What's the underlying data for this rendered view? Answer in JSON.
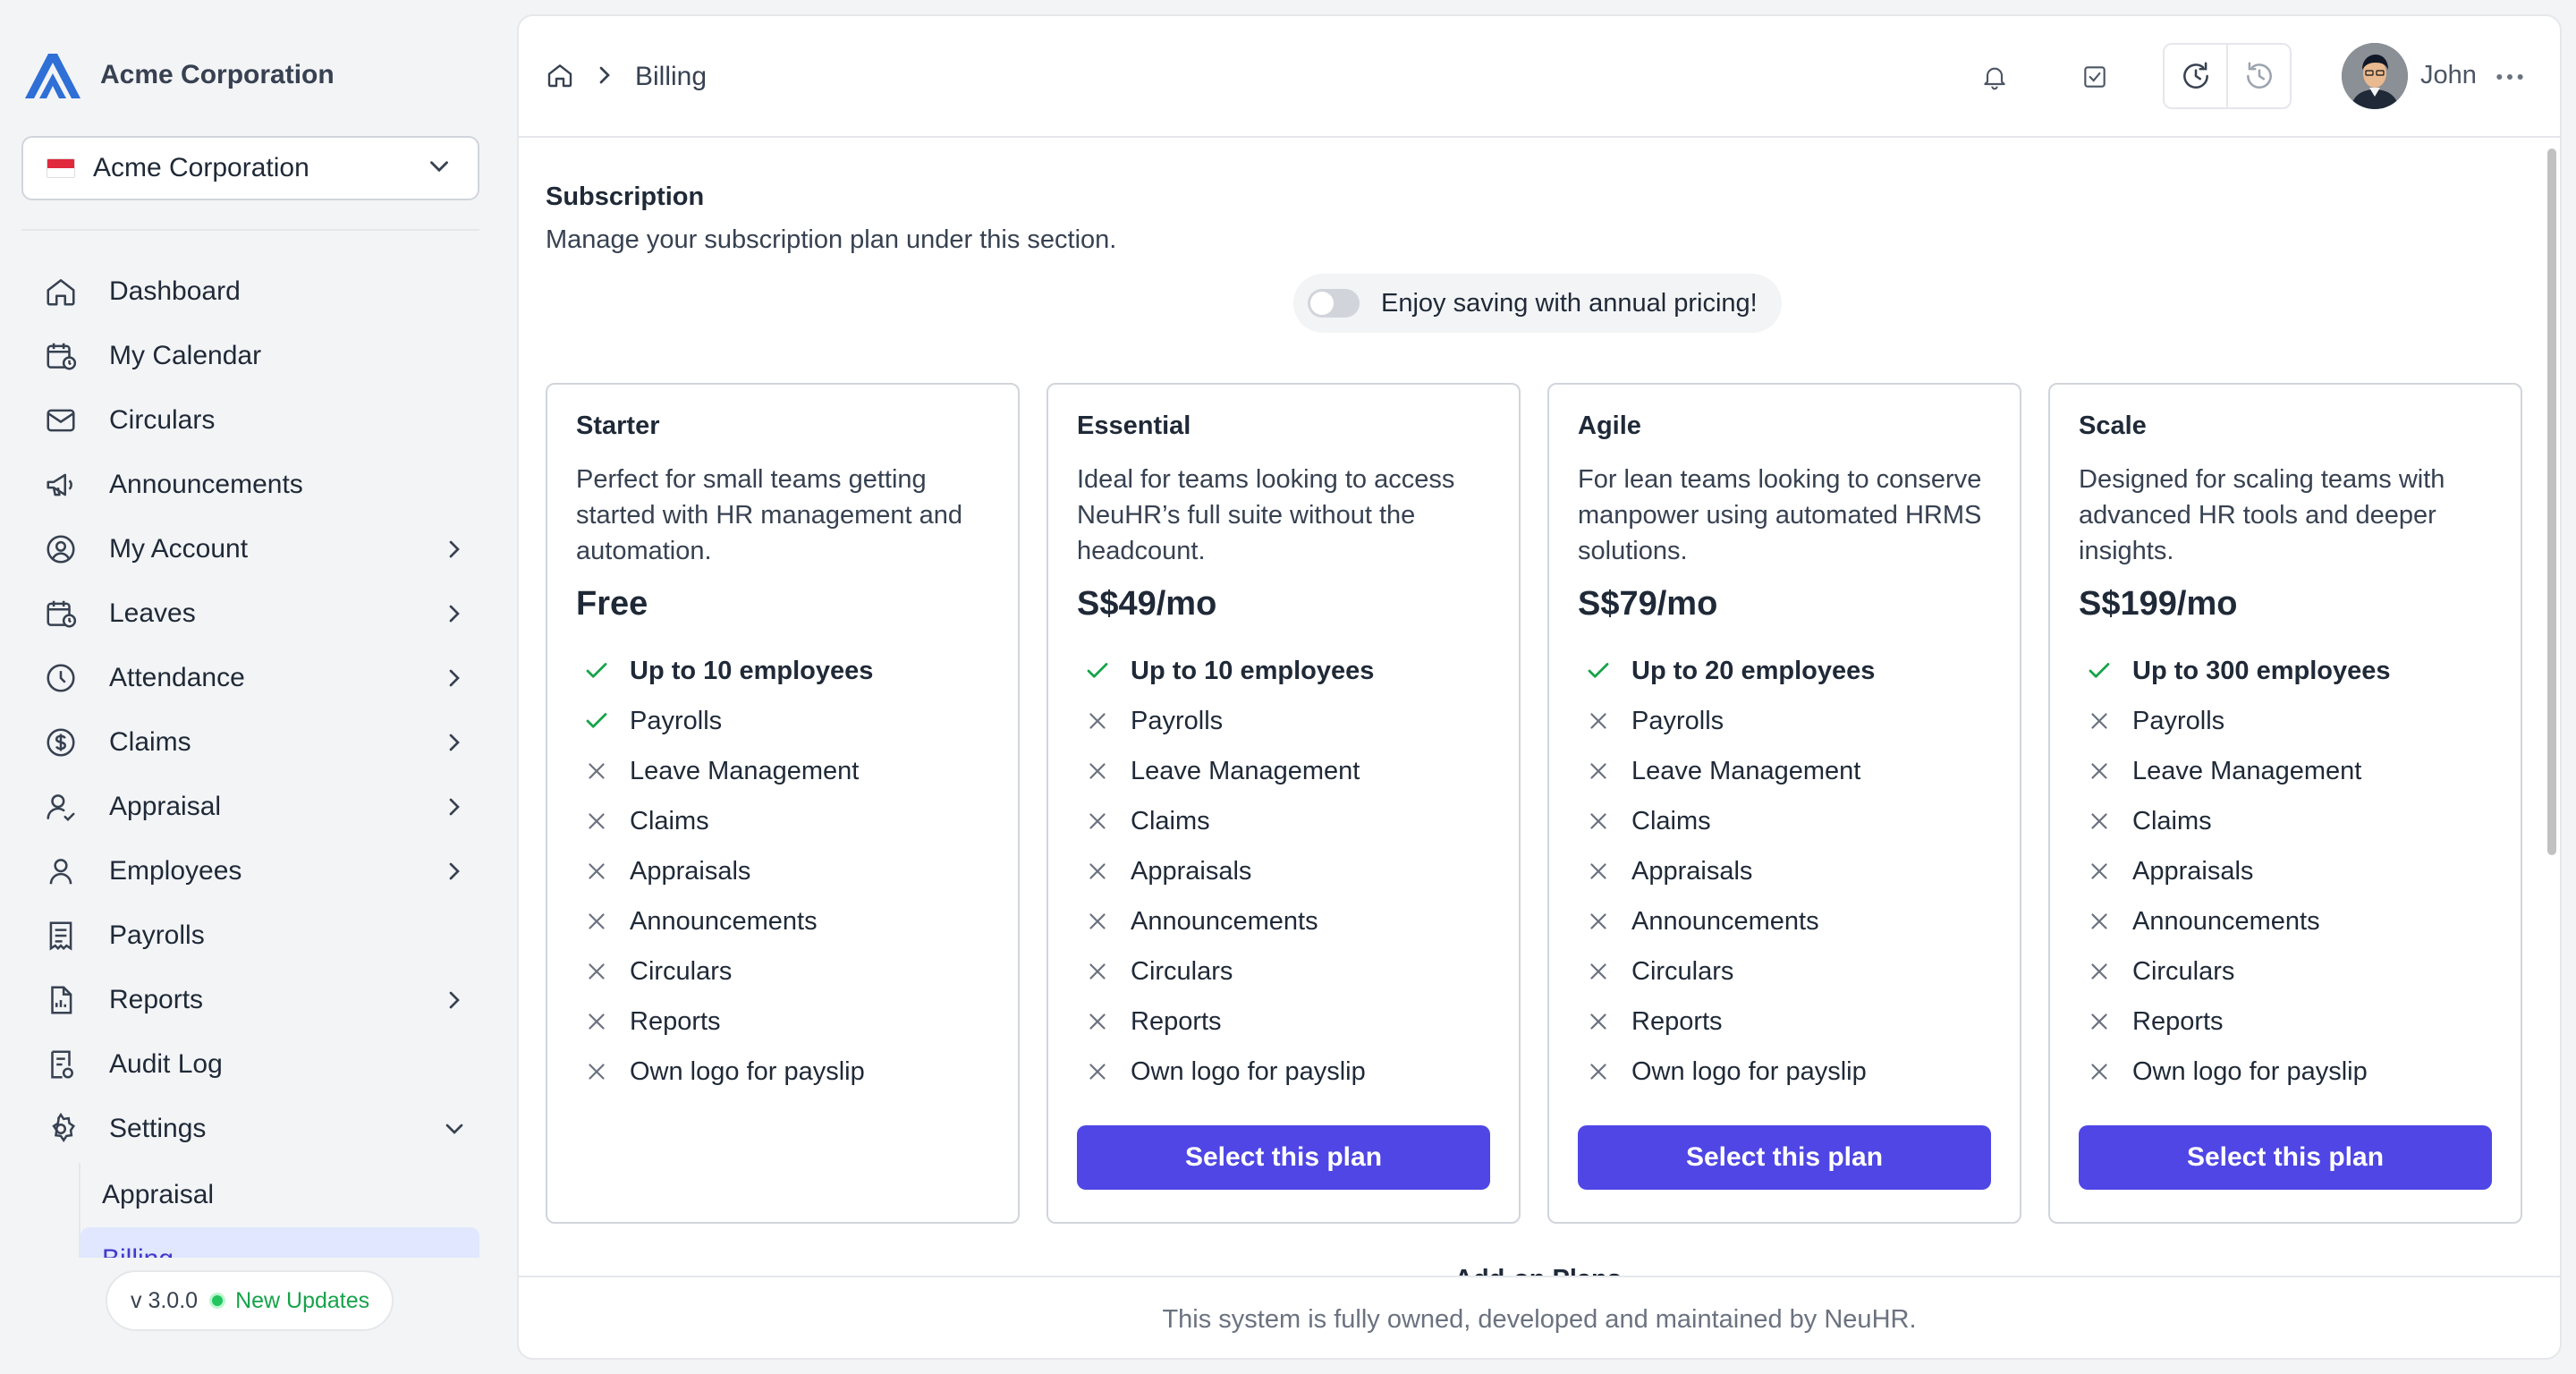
{
  "brand": {
    "name": "Acme Corporation"
  },
  "org_selector": {
    "value": "Acme Corporation"
  },
  "sidebar": {
    "items": [
      {
        "label": "Dashboard",
        "icon": "home-icon",
        "has_children": false
      },
      {
        "label": "My Calendar",
        "icon": "calendar-icon",
        "has_children": false
      },
      {
        "label": "Circulars",
        "icon": "mail-icon",
        "has_children": false
      },
      {
        "label": "Announcements",
        "icon": "megaphone-icon",
        "has_children": false
      },
      {
        "label": "My Account",
        "icon": "user-circle-icon",
        "has_children": true
      },
      {
        "label": "Leaves",
        "icon": "calendar-clock-icon",
        "has_children": true
      },
      {
        "label": "Attendance",
        "icon": "clock-icon",
        "has_children": true
      },
      {
        "label": "Claims",
        "icon": "dollar-circle-icon",
        "has_children": true
      },
      {
        "label": "Appraisal",
        "icon": "user-check-icon",
        "has_children": true
      },
      {
        "label": "Employees",
        "icon": "user-icon",
        "has_children": true
      },
      {
        "label": "Payrolls",
        "icon": "receipt-icon",
        "has_children": false
      },
      {
        "label": "Reports",
        "icon": "report-icon",
        "has_children": true
      },
      {
        "label": "Audit Log",
        "icon": "audit-icon",
        "has_children": false
      },
      {
        "label": "Settings",
        "icon": "gear-icon",
        "has_children": true,
        "expanded": true
      }
    ],
    "settings_children": [
      {
        "label": "Appraisal",
        "active": false
      },
      {
        "label": "Billing",
        "active": true
      }
    ],
    "version": "v 3.0.0",
    "updates_label": "New Updates"
  },
  "header": {
    "breadcrumb_current": "Billing",
    "user_name": "John"
  },
  "subscription": {
    "title": "Subscription",
    "description": "Manage your subscription plan under this section.",
    "annual_toggle_label": "Enjoy saving with annual pricing!",
    "annual_toggle_on": false
  },
  "plans": [
    {
      "name": "Starter",
      "description": "Perfect for small teams getting started with HR management and automation.",
      "price": "Free",
      "features": [
        {
          "label": "Up to 10 employees",
          "included": true
        },
        {
          "label": "Payrolls",
          "included": true
        },
        {
          "label": "Leave Management",
          "included": false
        },
        {
          "label": "Claims",
          "included": false
        },
        {
          "label": "Appraisals",
          "included": false
        },
        {
          "label": "Announcements",
          "included": false
        },
        {
          "label": "Circulars",
          "included": false
        },
        {
          "label": "Reports",
          "included": false
        },
        {
          "label": "Own logo for payslip",
          "included": false
        }
      ],
      "button": null
    },
    {
      "name": "Essential",
      "description": "Ideal for teams looking to access NeuHR’s full suite without the headcount.",
      "price": "S$49/mo",
      "features": [
        {
          "label": "Up to 10 employees",
          "included": true
        },
        {
          "label": "Payrolls",
          "included": false
        },
        {
          "label": "Leave Management",
          "included": false
        },
        {
          "label": "Claims",
          "included": false
        },
        {
          "label": "Appraisals",
          "included": false
        },
        {
          "label": "Announcements",
          "included": false
        },
        {
          "label": "Circulars",
          "included": false
        },
        {
          "label": "Reports",
          "included": false
        },
        {
          "label": "Own logo for payslip",
          "included": false
        }
      ],
      "button": "Select this plan"
    },
    {
      "name": "Agile",
      "description": "For lean teams looking to conserve manpower using automated HRMS solutions.",
      "price": "S$79/mo",
      "features": [
        {
          "label": "Up to 20 employees",
          "included": true
        },
        {
          "label": "Payrolls",
          "included": false
        },
        {
          "label": "Leave Management",
          "included": false
        },
        {
          "label": "Claims",
          "included": false
        },
        {
          "label": "Appraisals",
          "included": false
        },
        {
          "label": "Announcements",
          "included": false
        },
        {
          "label": "Circulars",
          "included": false
        },
        {
          "label": "Reports",
          "included": false
        },
        {
          "label": "Own logo for payslip",
          "included": false
        }
      ],
      "button": "Select this plan"
    },
    {
      "name": "Scale",
      "description": "Designed for scaling teams with advanced HR tools and deeper insights.",
      "price": "S$199/mo",
      "features": [
        {
          "label": "Up to 300 employees",
          "included": true
        },
        {
          "label": "Payrolls",
          "included": false
        },
        {
          "label": "Leave Management",
          "included": false
        },
        {
          "label": "Claims",
          "included": false
        },
        {
          "label": "Appraisals",
          "included": false
        },
        {
          "label": "Announcements",
          "included": false
        },
        {
          "label": "Circulars",
          "included": false
        },
        {
          "label": "Reports",
          "included": false
        },
        {
          "label": "Own logo for payslip",
          "included": false
        }
      ],
      "button": "Select this plan"
    }
  ],
  "addons": {
    "title": "Add-on Plans"
  },
  "footer": {
    "text": "This system is fully owned, developed and maintained by NeuHR."
  },
  "colors": {
    "accent": "#4f46e5",
    "check": "#16a34a",
    "cross": "#6b7280",
    "active_nav_bg": "#e0e7ff"
  }
}
